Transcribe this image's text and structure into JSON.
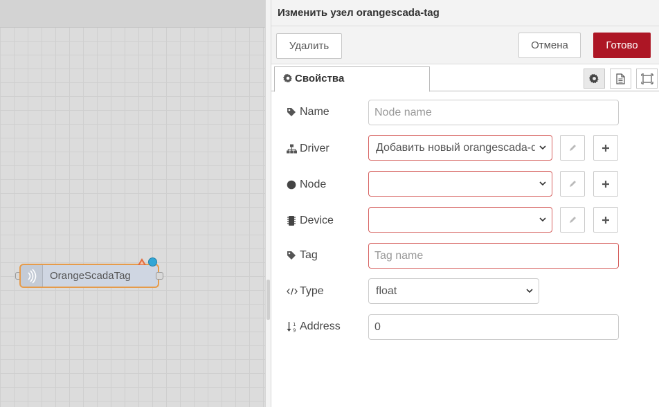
{
  "workspace": {
    "node": {
      "label": "OrangeScadaTag"
    }
  },
  "tray": {
    "title": "Изменить узел orangescada-tag",
    "toolbar": {
      "delete_label": "Удалить",
      "cancel_label": "Отмена",
      "done_label": "Готово"
    },
    "tabs": {
      "properties_label": "Свойства"
    },
    "form": {
      "name": {
        "label": "Name",
        "value": "",
        "placeholder": "Node name"
      },
      "driver": {
        "label": "Driver",
        "value": "Добавить новый orangescada-driver..."
      },
      "node": {
        "label": "Node",
        "value": ""
      },
      "device": {
        "label": "Device",
        "value": ""
      },
      "tag": {
        "label": "Tag",
        "value": "",
        "placeholder": "Tag name"
      },
      "type": {
        "label": "Type",
        "value": "float"
      },
      "address": {
        "label": "Address",
        "value": "0"
      }
    }
  },
  "colors": {
    "accent": "#ad1625",
    "invalid_border": "#d6615f",
    "node_border": "#e69b4a",
    "node_fill": "#cfd6e2",
    "status_dot": "#31a6d6",
    "warning": "#e26d3f"
  },
  "icons": [
    "tag-icon",
    "sitemap-icon",
    "circle-icon",
    "chip-icon",
    "code-icon",
    "sort-numeric-icon",
    "gear-icon",
    "file-icon",
    "frame-icon",
    "pencil-icon",
    "plus-icon",
    "chevron-down-icon",
    "rss-icon"
  ]
}
